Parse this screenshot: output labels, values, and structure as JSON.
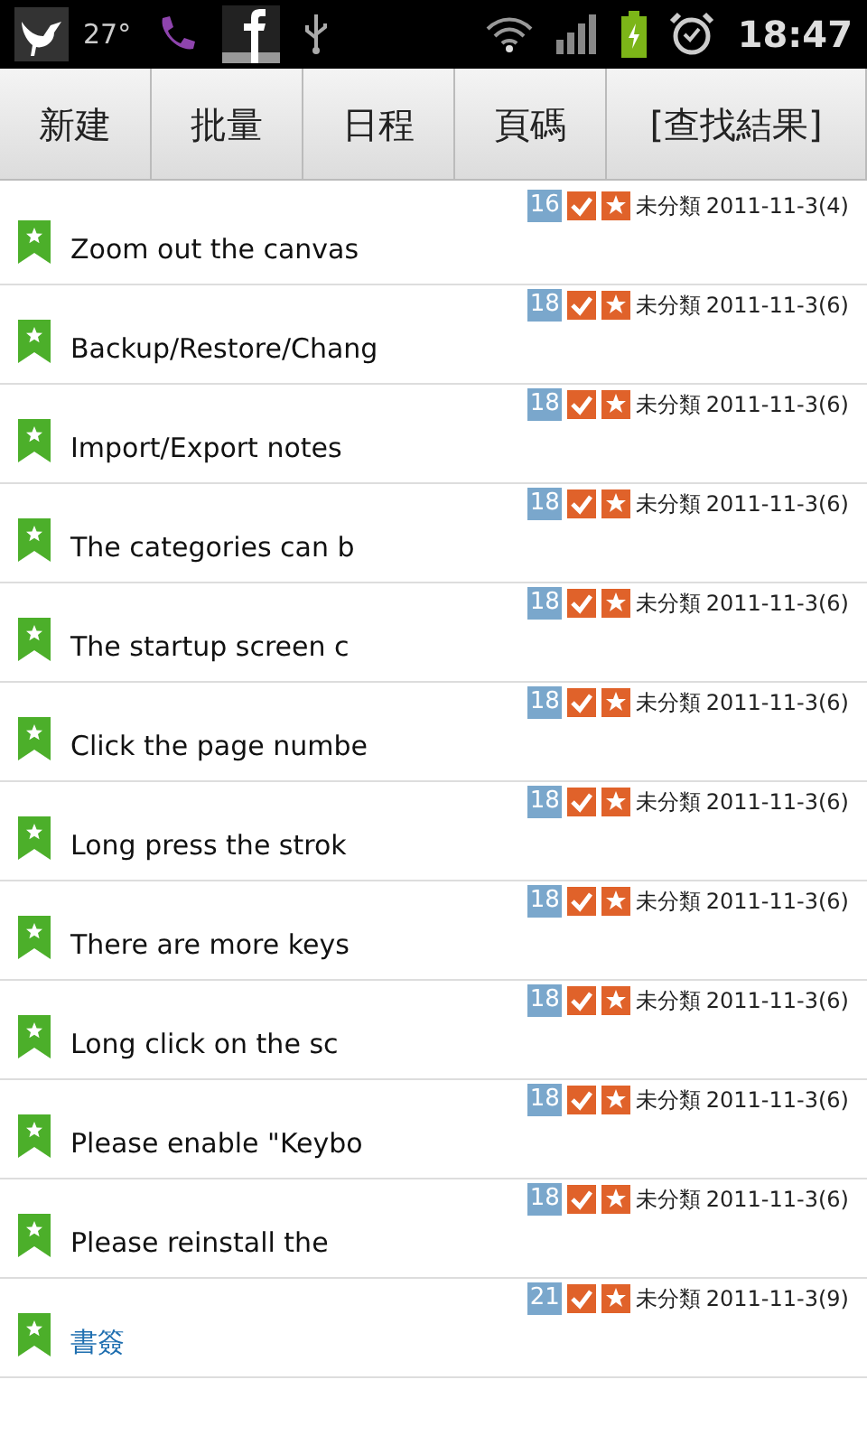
{
  "status_bar": {
    "temperature": "27°",
    "time": "18:47"
  },
  "toolbar": [
    {
      "label": "新建"
    },
    {
      "label": "批量"
    },
    {
      "label": "日程"
    },
    {
      "label": "頁碼"
    },
    {
      "label": "[查找結果]"
    }
  ],
  "notes": [
    {
      "kind": "note",
      "title": "Zoom out the canvas",
      "count": "16",
      "category": "未分類",
      "date": "2011-11-3(4)"
    },
    {
      "kind": "note",
      "title": "Backup/Restore/Chang",
      "count": "18",
      "category": "未分類",
      "date": "2011-11-3(6)"
    },
    {
      "kind": "note",
      "title": "Import/Export notes",
      "count": "18",
      "category": "未分類",
      "date": "2011-11-3(6)"
    },
    {
      "kind": "note",
      "title": "The categories can b",
      "count": "18",
      "category": "未分類",
      "date": "2011-11-3(6)"
    },
    {
      "kind": "note",
      "title": "The startup screen c",
      "count": "18",
      "category": "未分類",
      "date": "2011-11-3(6)"
    },
    {
      "kind": "note",
      "title": "Click the page numbe",
      "count": "18",
      "category": "未分類",
      "date": "2011-11-3(6)"
    },
    {
      "kind": "note",
      "title": "Long press the strok",
      "count": "18",
      "category": "未分類",
      "date": "2011-11-3(6)"
    },
    {
      "kind": "note",
      "title": "There are more keys",
      "count": "18",
      "category": "未分類",
      "date": "2011-11-3(6)"
    },
    {
      "kind": "note",
      "title": "Long click on the sc",
      "count": "18",
      "category": "未分類",
      "date": "2011-11-3(6)"
    },
    {
      "kind": "note",
      "title": "Please enable \"Keybo",
      "count": "18",
      "category": "未分類",
      "date": "2011-11-3(6)"
    },
    {
      "kind": "note",
      "title": "Please reinstall the",
      "count": "18",
      "category": "未分類",
      "date": "2011-11-3(6)"
    },
    {
      "kind": "link",
      "title": "書簽",
      "count": "21",
      "category": "未分類",
      "date": "2011-11-3(9)"
    }
  ]
}
